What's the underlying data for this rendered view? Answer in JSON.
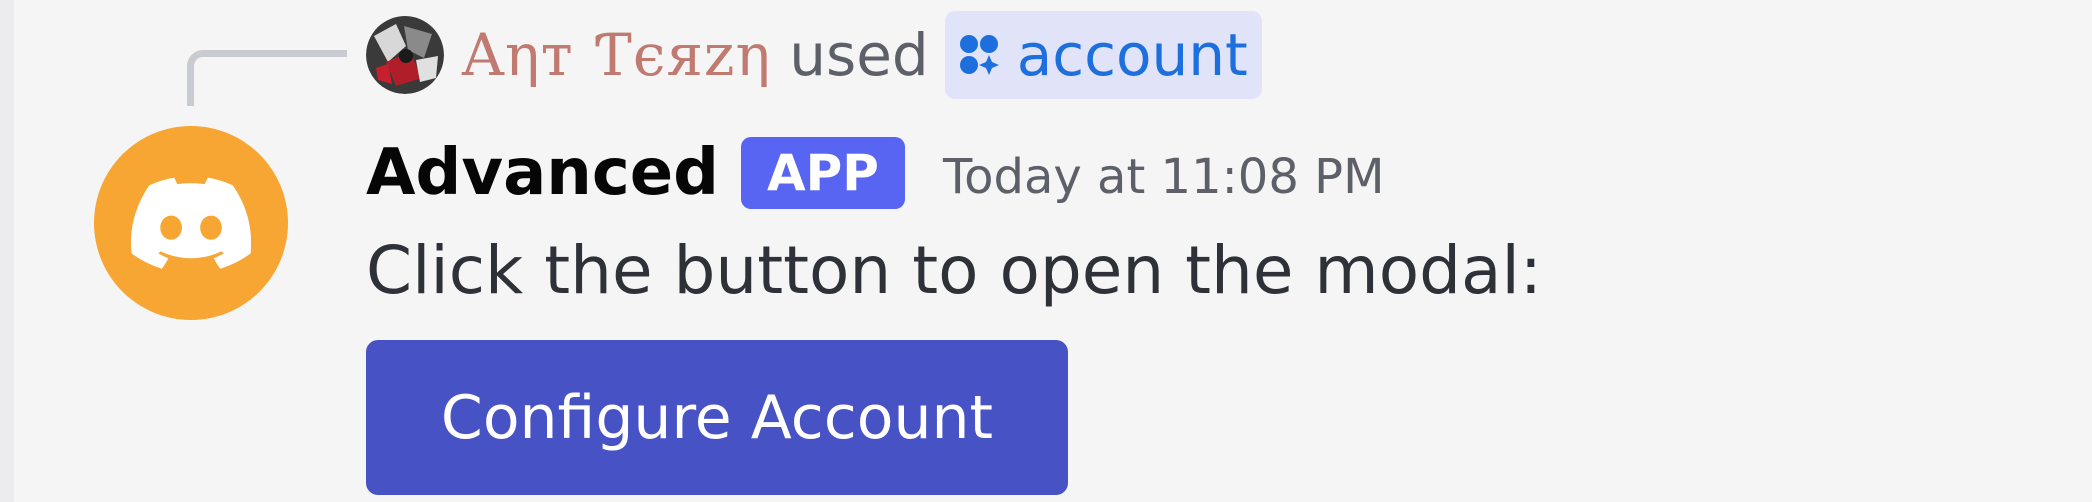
{
  "reply": {
    "username": "Aηт Ƭєяzη",
    "used_text": "used",
    "command_icon": "app-command-icon",
    "command_name": "account"
  },
  "message": {
    "bot_name": "Advanced",
    "badge": "APP",
    "timestamp": "Today at 11:08 PM",
    "content": "Click the button to open the modal:",
    "button_label": "Configure Account",
    "bot_avatar_icon": "discord-logo-icon"
  },
  "colors": {
    "username": "#c07a70",
    "command_link": "#1d6fde",
    "badge_bg": "#5865f2",
    "button_bg": "#4752c4",
    "bot_avatar_bg": "#f7a634"
  }
}
